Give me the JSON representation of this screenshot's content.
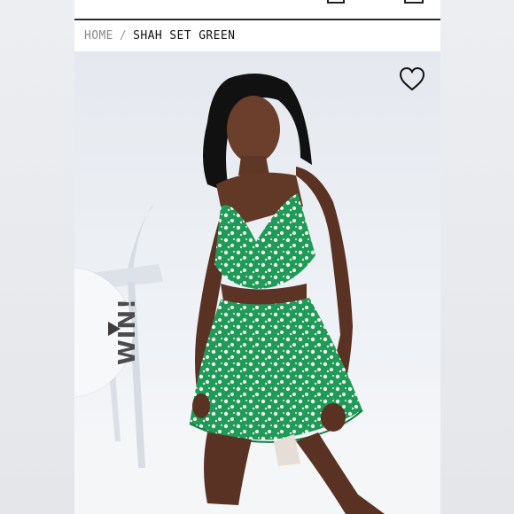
{
  "breadcrumb": {
    "home": "HOME",
    "separator": "/",
    "current": "SHAH SET GREEN"
  },
  "product_image": {
    "badge_text": "WIN!",
    "wishlist_icon": "heart-outline-icon"
  },
  "topbar_icons": [
    "account-icon",
    "wishlist-icon",
    "bag-icon"
  ],
  "colors": {
    "dress_green": "#1f9a57",
    "background": "#e9ebee",
    "text_dark": "#111111",
    "text_muted": "#8a8a8a"
  }
}
